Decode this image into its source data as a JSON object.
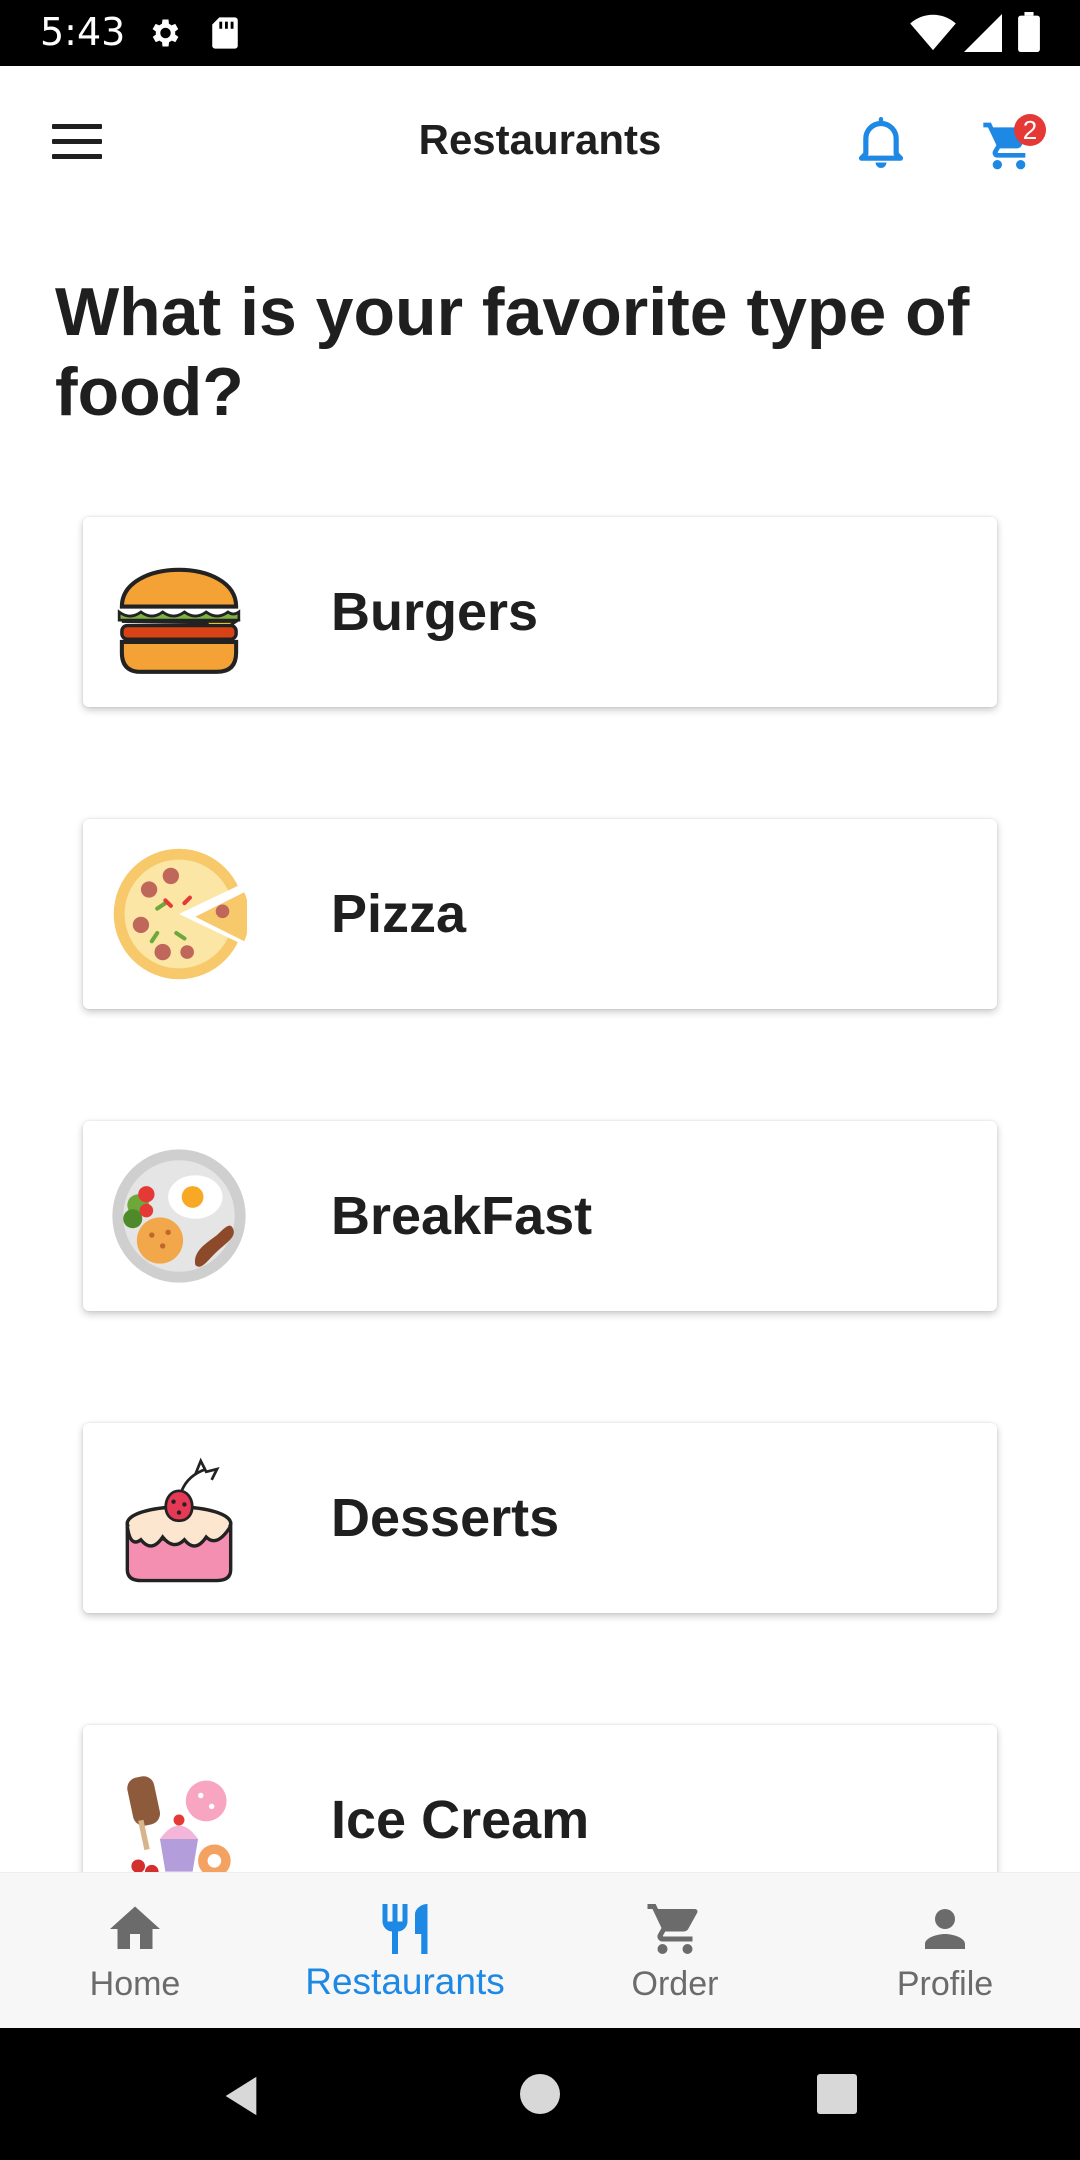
{
  "status_bar": {
    "time": "5:43",
    "icons": [
      "gear-icon",
      "sd-card-icon",
      "wifi-icon",
      "signal-icon",
      "battery-icon"
    ]
  },
  "app_bar": {
    "title": "Restaurants",
    "menu_icon": "hamburger-menu-icon",
    "notification_icon": "bell-icon",
    "cart_icon": "cart-icon",
    "cart_count": "2"
  },
  "heading": "What is your favorite type of food?",
  "categories": [
    {
      "label": "Burgers",
      "icon": "burger-icon"
    },
    {
      "label": "Pizza",
      "icon": "pizza-icon"
    },
    {
      "label": "BreakFast",
      "icon": "breakfast-plate-icon"
    },
    {
      "label": "Desserts",
      "icon": "cake-icon"
    },
    {
      "label": "Ice Cream",
      "icon": "ice-cream-icon"
    }
  ],
  "bottom_nav": {
    "active": "Restaurants",
    "items": [
      {
        "label": "Home",
        "icon": "home-icon"
      },
      {
        "label": "Restaurants",
        "icon": "fork-knife-icon"
      },
      {
        "label": "Order",
        "icon": "cart-icon"
      },
      {
        "label": "Profile",
        "icon": "person-icon"
      }
    ]
  },
  "colors": {
    "accent": "#1e88e5",
    "badge": "#e53935",
    "text": "#1f1f1f",
    "inactive": "#6b6b6b"
  }
}
